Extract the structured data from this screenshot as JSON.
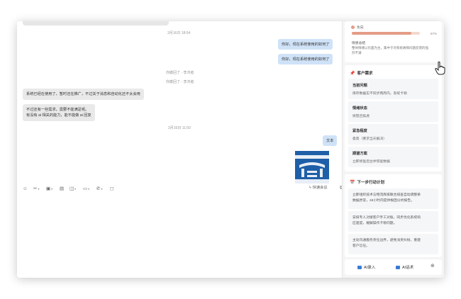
{
  "chat": {
    "timestamp1": "3月16日 18:04",
    "msg_right_1": "你好，现在系统使用的如何了",
    "msg_right_2": "你好，现在系统使用的如何了",
    "recall_1": "你撤回了 - 李鸿者",
    "recall_2": "你撤回了 - 李鸿者",
    "msg_left_1": "系统已经在使用了，暂时还在推广，不过关于消息和自动化还不太会用",
    "msg_left_2_line1": "不过还有一些需求，需要不能满足呢。",
    "msg_left_2_line2": "有没有 ai 相关的能力，能不能做 ai 回复",
    "timestamp2": "3月16日 11:50",
    "msg_right_text": "文本"
  },
  "toolbar": {
    "icons": [
      "smile-icon",
      "scissors-icon",
      "image-icon",
      "file-icon",
      "screenshot-icon",
      "folder-icon",
      "phone-icon",
      "message-icon"
    ],
    "quick_meeting": "快速会议"
  },
  "panel": {
    "sentiment": {
      "label": "负向",
      "percent": "87%",
      "level": 0.87,
      "analysis_title": "情感总结",
      "analysis_line1": "整体情绪以负面为主，集中于对系统故障问题反馈的强",
      "analysis_line2": "烈不满"
    },
    "needs": {
      "title": "客户需求",
      "items": [
        {
          "title": "当前问题",
          "body": "库存数据实不同步两周内，系统卡顿"
        },
        {
          "title": "情绪状态",
          "body": "愤怒且焦虑"
        },
        {
          "title": "紧急程度",
          "body": "极高（要求当天解决）"
        },
        {
          "title": "期望方案",
          "body": "立即修复后台并恢复数据"
        }
      ]
    },
    "plan": {
      "title": "下一步行动计划",
      "items": [
        {
          "line1": "立即组织技术与物流库排联合排查自动调整单",
          "line2": "数据异常，48小时内提供根因分析报告。"
        },
        {
          "line1": "安排专人对接客户手工对账，同步优化系统响",
          "line2": "应速度，缓解操作卡顿问题。"
        },
        {
          "line1": "主动沟通服务责任边界，避免浅责纠纷，重建",
          "line2": "客户信任。"
        }
      ]
    },
    "bottom": {
      "ai_input": "AI录入",
      "ai_speech": "AI话术"
    }
  },
  "colors": {
    "bubble_right": "#cfe2f7",
    "bubble_left": "#e9e9e9",
    "sentiment_bar": "#e39c86",
    "accent": "#3a7bd5"
  }
}
